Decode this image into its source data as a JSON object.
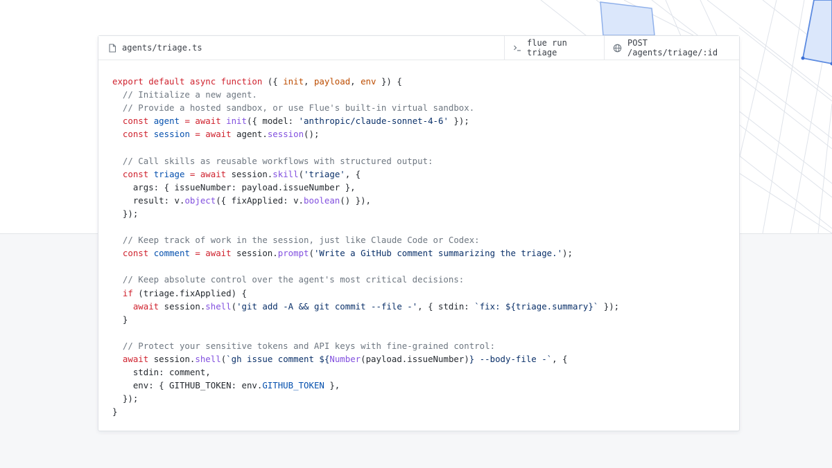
{
  "editor": {
    "file_tab": {
      "icon": "file-icon",
      "label": "agents/triage.ts"
    },
    "command_tab": {
      "icon": "terminal-prompt-icon",
      "label": "flue run triage"
    },
    "route_tab": {
      "icon": "globe-icon",
      "label": "POST /agents/triage/:id"
    }
  },
  "code": {
    "lines": [
      [
        [
          "kw",
          "export default async function"
        ],
        [
          "pl",
          " ({ "
        ],
        [
          "param",
          "init"
        ],
        [
          "pl",
          ", "
        ],
        [
          "param",
          "payload"
        ],
        [
          "pl",
          ", "
        ],
        [
          "param",
          "env"
        ],
        [
          "pl",
          " }) {"
        ]
      ],
      [
        [
          "cm",
          "  // Initialize a new agent."
        ]
      ],
      [
        [
          "cm",
          "  // Provide a hosted sandbox, or use Flue's built-in virtual sandbox."
        ]
      ],
      [
        [
          "kw",
          "  const "
        ],
        [
          "var",
          "agent"
        ],
        [
          "kw",
          " = await "
        ],
        [
          "fn",
          "init"
        ],
        [
          "pl",
          "({ model: "
        ],
        [
          "str",
          "'anthropic/claude-sonnet-4-6'"
        ],
        [
          "pl",
          " });"
        ]
      ],
      [
        [
          "kw",
          "  const "
        ],
        [
          "var",
          "session"
        ],
        [
          "kw",
          " = await "
        ],
        [
          "pl",
          "agent."
        ],
        [
          "fn",
          "session"
        ],
        [
          "pl",
          "();"
        ]
      ],
      [],
      [
        [
          "cm",
          "  // Call skills as reusable workflows with structured output:"
        ]
      ],
      [
        [
          "kw",
          "  const "
        ],
        [
          "var",
          "triage"
        ],
        [
          "kw",
          " = await "
        ],
        [
          "pl",
          "session."
        ],
        [
          "fn",
          "skill"
        ],
        [
          "pl",
          "("
        ],
        [
          "str",
          "'triage'"
        ],
        [
          "pl",
          ", {"
        ]
      ],
      [
        [
          "pl",
          "    args: { issueNumber: payload.issueNumber },"
        ]
      ],
      [
        [
          "pl",
          "    result: v."
        ],
        [
          "fn",
          "object"
        ],
        [
          "pl",
          "({ fixApplied: v."
        ],
        [
          "fn",
          "boolean"
        ],
        [
          "pl",
          "() }),"
        ]
      ],
      [
        [
          "pl",
          "  });"
        ]
      ],
      [],
      [
        [
          "cm",
          "  // Keep track of work in the session, just like Claude Code or Codex:"
        ]
      ],
      [
        [
          "kw",
          "  const "
        ],
        [
          "var",
          "comment"
        ],
        [
          "kw",
          " = await "
        ],
        [
          "pl",
          "session."
        ],
        [
          "fn",
          "prompt"
        ],
        [
          "pl",
          "("
        ],
        [
          "str",
          "'Write a GitHub comment summarizing the triage.'"
        ],
        [
          "pl",
          ");"
        ]
      ],
      [],
      [
        [
          "cm",
          "  // Keep absolute control over the agent's most critical decisions:"
        ]
      ],
      [
        [
          "kw",
          "  if"
        ],
        [
          "pl",
          " (triage.fixApplied) {"
        ]
      ],
      [
        [
          "kw",
          "    await "
        ],
        [
          "pl",
          "session."
        ],
        [
          "fn",
          "shell"
        ],
        [
          "pl",
          "("
        ],
        [
          "str",
          "'git add -A && git commit --file -'"
        ],
        [
          "pl",
          ", { stdin: "
        ],
        [
          "str",
          "`fix: ${triage.summary}`"
        ],
        [
          "pl",
          " });"
        ]
      ],
      [
        [
          "pl",
          "  }"
        ]
      ],
      [],
      [
        [
          "cm",
          "  // Protect your sensitive tokens and API keys with fine-grained control:"
        ]
      ],
      [
        [
          "kw",
          "  await "
        ],
        [
          "pl",
          "session."
        ],
        [
          "fn",
          "shell"
        ],
        [
          "pl",
          "("
        ],
        [
          "str",
          "`gh issue comment ${"
        ],
        [
          "fn",
          "Number"
        ],
        [
          "pl",
          "(payload.issueNumber)"
        ],
        [
          "str",
          "} --body-file -`"
        ],
        [
          "pl",
          ", {"
        ]
      ],
      [
        [
          "pl",
          "    stdin: comment,"
        ]
      ],
      [
        [
          "pl",
          "    env: { GITHUB_TOKEN: env."
        ],
        [
          "var",
          "GITHUB_TOKEN"
        ],
        [
          "pl",
          " },"
        ]
      ],
      [
        [
          "pl",
          "  });"
        ]
      ],
      [
        [
          "pl",
          "}"
        ]
      ]
    ]
  },
  "colors": {
    "keyword": "#cf222e",
    "parameter": "#bc4c00",
    "variable": "#0550ae",
    "function": "#8250df",
    "string": "#0a3069",
    "comment": "#6e7781",
    "accent_grid": "#3b6fd6"
  }
}
